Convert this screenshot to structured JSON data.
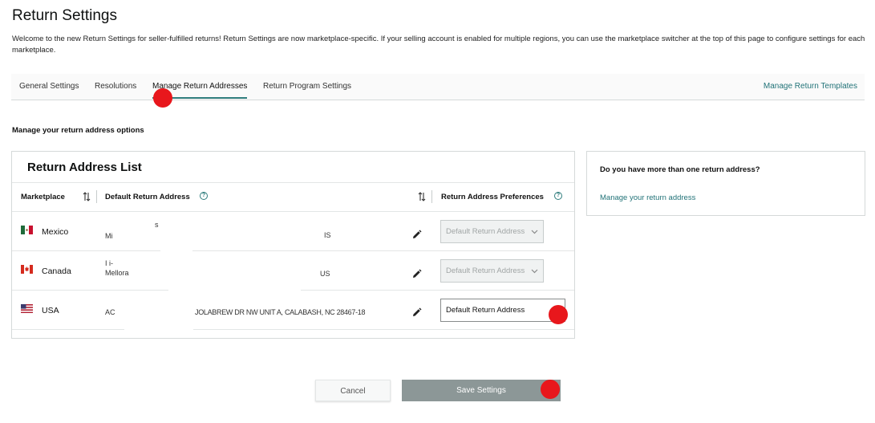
{
  "page": {
    "title": "Return Settings",
    "intro": "Welcome to the new Return Settings for seller-fulfilled returns! Return Settings are now marketplace-specific. If your selling account is enabled for multiple regions, you can use the marketplace switcher at the top of this page to configure settings for each marketplace."
  },
  "tabs": {
    "items": [
      {
        "label": "General Settings",
        "active": false
      },
      {
        "label": "Resolutions",
        "active": false
      },
      {
        "label": "Manage Return Addresses",
        "active": true
      },
      {
        "label": "Return Program Settings",
        "active": false
      }
    ],
    "templates_link": "Manage Return Templates"
  },
  "section": {
    "subheading": "Manage your return address options"
  },
  "address_list": {
    "title": "Return Address List",
    "headers": {
      "marketplace": "Marketplace",
      "default_address": "Default Return Address",
      "preferences": "Return Address Preferences",
      "help_glyph": "?"
    },
    "rows": [
      {
        "country": "Mexico",
        "flag": "mexico-flag-icon",
        "addr_line1": "s",
        "addr_line2": "Mi",
        "addr_tail": "IS",
        "preference": "Default Return Address",
        "enabled": false
      },
      {
        "country": "Canada",
        "flag": "canada-flag-icon",
        "addr_line1": "I                                    i-",
        "addr_line2": "Mellora",
        "addr_tail": "US",
        "preference": "Default Return Address",
        "enabled": false
      },
      {
        "country": "USA",
        "flag": "usa-flag-icon",
        "addr_line1": "AC",
        "addr_line2": "",
        "addr_tail": "JOLABREW DR NW UNIT A, CALABASH, NC 28467-18",
        "preference": "Default Return Address",
        "enabled": true
      }
    ]
  },
  "side_panel": {
    "question": "Do you have more than one return address?",
    "link": "Manage your return address"
  },
  "actions": {
    "cancel": "Cancel",
    "save": "Save Settings"
  },
  "colors": {
    "link": "#227378",
    "active_tab_underline": "#2f7d7d",
    "save_button": "#8c9797",
    "click_marker": "#e8171c"
  }
}
